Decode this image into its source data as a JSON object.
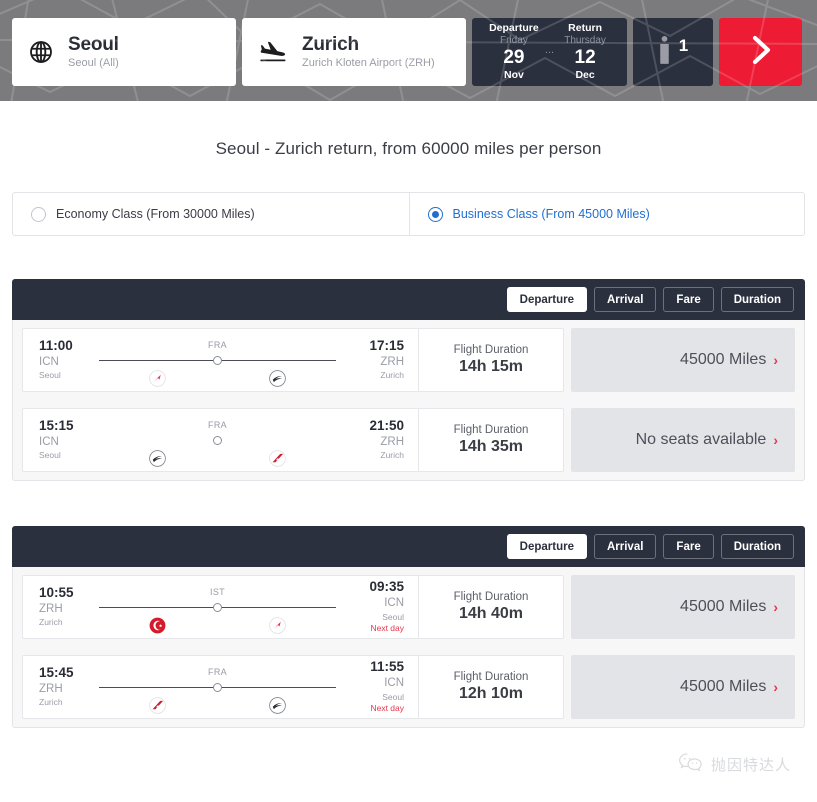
{
  "search_bar": {
    "origin": {
      "icon": "globe-icon",
      "city": "Seoul",
      "detail": "Seoul (All)"
    },
    "destination": {
      "icon": "plane-landing-icon",
      "city": "Zurich",
      "detail": "Zurich Kloten Airport (ZRH)"
    },
    "dates": {
      "departure": {
        "label": "Departure",
        "weekday": "Friday",
        "day": "29",
        "month": "Nov"
      },
      "separator": "...",
      "return": {
        "label": "Return",
        "weekday": "Thursday",
        "day": "12",
        "month": "Dec"
      }
    },
    "passengers": {
      "icon": "person-icon",
      "count": "1"
    },
    "submit": {
      "icon": "chevron-right-icon",
      "color": "#ed1b34"
    }
  },
  "page_title": "Seoul - Zurich return, from 60000 miles per person",
  "cabin_classes": [
    {
      "label": "Economy Class (From 30000 Miles)",
      "selected": false
    },
    {
      "label": "Business Class (From 45000 Miles)",
      "selected": true
    }
  ],
  "colors": {
    "accent_red": "#ed1b34",
    "link_blue": "#1f6fd0",
    "dark_bar": "#2b303e",
    "fare_bg": "#e2e4e8"
  },
  "sort_options": [
    "Departure",
    "Arrival",
    "Fare",
    "Duration"
  ],
  "active_sort": "Departure",
  "outbound": {
    "sort_options": [
      "Departure",
      "Arrival",
      "Fare",
      "Duration"
    ],
    "active_sort": "Departure",
    "flights": [
      {
        "depart_time": "11:00",
        "depart_code": "ICN",
        "depart_city": "Seoul",
        "arrive_time": "17:15",
        "arrive_code": "ZRH",
        "arrive_city": "Zurich",
        "arrive_nextday": "",
        "stop_code": "FRA",
        "has_line": true,
        "airline1": "asiana-logo",
        "airline2": "lufthansa-logo",
        "duration_label": "Flight Duration",
        "duration_value": "14h 15m",
        "fare": "45000 Miles",
        "available": true
      },
      {
        "depart_time": "15:15",
        "depart_code": "ICN",
        "depart_city": "Seoul",
        "arrive_time": "21:50",
        "arrive_code": "ZRH",
        "arrive_city": "Zurich",
        "arrive_nextday": "",
        "stop_code": "FRA",
        "has_line": false,
        "airline1": "lufthansa-logo",
        "airline2": "austrian-logo",
        "duration_label": "Flight Duration",
        "duration_value": "14h 35m",
        "fare": "No seats available",
        "available": false
      }
    ]
  },
  "inbound": {
    "sort_options": [
      "Departure",
      "Arrival",
      "Fare",
      "Duration"
    ],
    "active_sort": "Departure",
    "flights": [
      {
        "depart_time": "10:55",
        "depart_code": "ZRH",
        "depart_city": "Zurich",
        "arrive_time": "09:35",
        "arrive_code": "ICN",
        "arrive_city": "Seoul",
        "arrive_nextday": "Next day",
        "stop_code": "IST",
        "has_line": true,
        "airline1": "turkish-logo",
        "airline2": "asiana-logo",
        "duration_label": "Flight Duration",
        "duration_value": "14h 40m",
        "fare": "45000 Miles",
        "available": true
      },
      {
        "depart_time": "15:45",
        "depart_code": "ZRH",
        "depart_city": "Zurich",
        "arrive_time": "11:55",
        "arrive_code": "ICN",
        "arrive_city": "Seoul",
        "arrive_nextday": "Next day",
        "stop_code": "FRA",
        "has_line": true,
        "airline1": "austrian-logo",
        "airline2": "lufthansa-logo",
        "duration_label": "Flight Duration",
        "duration_value": "12h 10m",
        "fare": "45000 Miles",
        "available": true
      }
    ]
  },
  "watermark": {
    "icon": "wechat-icon",
    "text": "抛因特达人"
  }
}
